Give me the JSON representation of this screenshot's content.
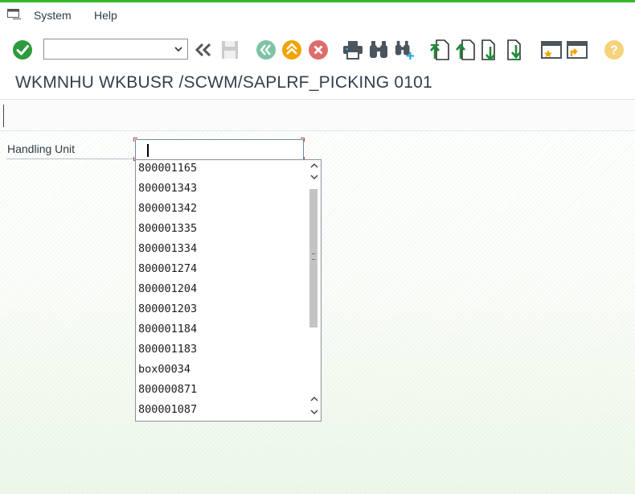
{
  "menubar": {
    "items": [
      {
        "label": "System"
      },
      {
        "label": "Help"
      }
    ]
  },
  "toolbar": {
    "command_field_value": "",
    "buttons": [
      {
        "name": "enter-icon"
      },
      {
        "name": "back-arrows-icon"
      },
      {
        "name": "save-icon"
      },
      {
        "name": "back-icon"
      },
      {
        "name": "exit-icon"
      },
      {
        "name": "cancel-icon"
      },
      {
        "name": "print-icon"
      },
      {
        "name": "find-icon"
      },
      {
        "name": "find-next-icon"
      },
      {
        "name": "first-page-icon"
      },
      {
        "name": "previous-page-icon"
      },
      {
        "name": "next-page-icon"
      },
      {
        "name": "last-page-icon"
      },
      {
        "name": "create-session-icon"
      },
      {
        "name": "generate-shortcut-icon"
      },
      {
        "name": "help-icon"
      }
    ]
  },
  "title": "WKMNHU WKBUSR /SCWM/SAPLRF_PICKING 0101",
  "form": {
    "handling_unit_label": "Handling Unit",
    "handling_unit_value": ""
  },
  "dropdown": {
    "options": [
      "800001165",
      "800001343",
      "800001342",
      "800001335",
      "800001334",
      "800001274",
      "800001204",
      "800001203",
      "800001184",
      "800001183",
      "box00034",
      "800000871",
      "800001087"
    ]
  },
  "colors": {
    "enter_green": "#2e9b3a",
    "nav_green": "#7dc4a4",
    "exit_orange": "#f0a400",
    "cancel_red": "#e06b6b",
    "page_green": "#1f8a3a",
    "top_edge_green": "#35b729"
  }
}
